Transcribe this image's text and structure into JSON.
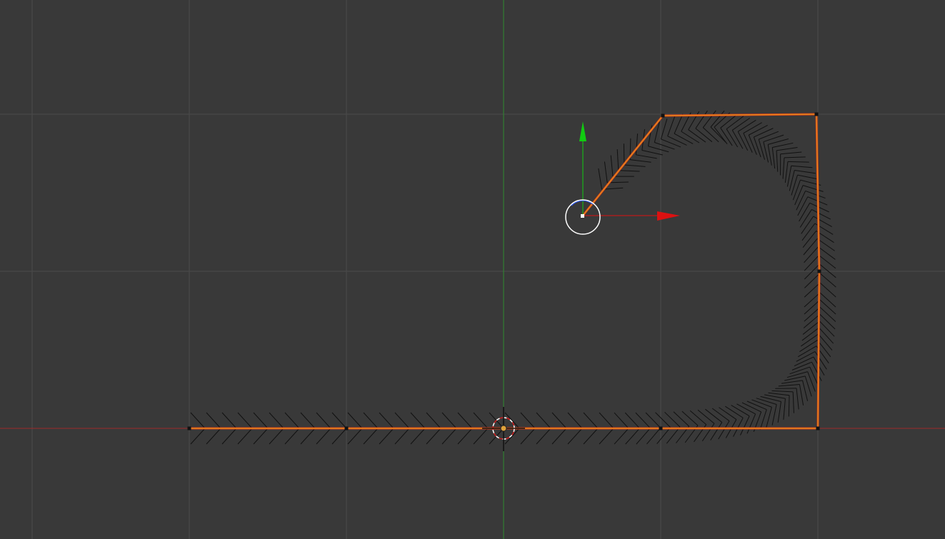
{
  "viewport": {
    "view": "Top Ortho",
    "background_color": "#393939",
    "grid_color": "#4a4a4a",
    "x_axis_color": "#a02a2a",
    "y_axis_color": "#2e8b2e"
  },
  "curve": {
    "type": "bezier-poly",
    "selected": true,
    "edge_color": "#e08a1e",
    "edge_highlight_color": "#d83a1a",
    "normals_color": "#111111"
  },
  "gizmo": {
    "x_color": "#dd1111",
    "y_color": "#11cc11",
    "z_color": "#2a54e8",
    "handle_icon": "circle-handle-icon"
  },
  "cursor_3d": {
    "icon": "cursor-3d-icon",
    "ring_colors": [
      "#ffffff",
      "#d21c1c"
    ]
  }
}
